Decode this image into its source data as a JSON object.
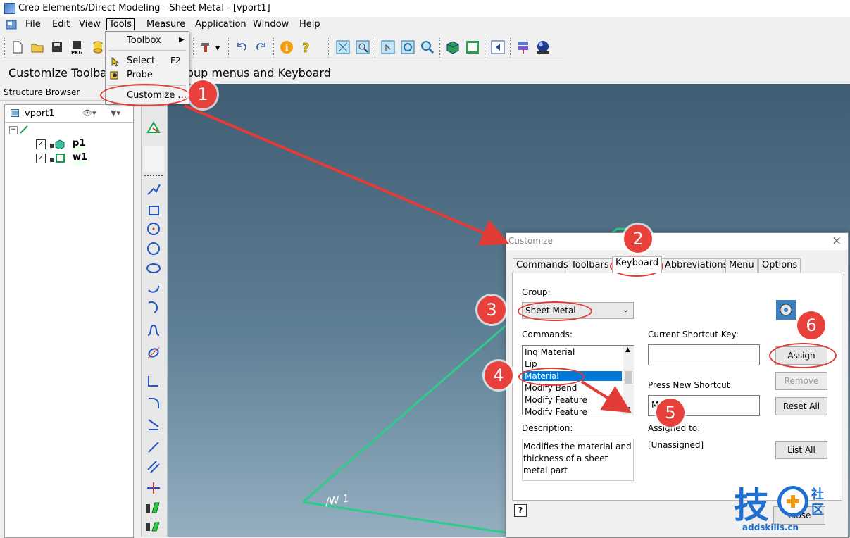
{
  "window": {
    "title": "Creo Elements/Direct Modeling - Sheet Metal - [vport1]"
  },
  "menubar": {
    "items": [
      "File",
      "Edit",
      "View",
      "Tools",
      "Measure",
      "Application",
      "Window",
      "Help"
    ]
  },
  "tools_menu": {
    "toolbox": "Toolbox",
    "select": "Select",
    "select_shortcut": "F2",
    "probe": "Probe",
    "customize": "Customize ..."
  },
  "status": {
    "prompt_left": "Customize Toolba",
    "prompt_right": "opup menus and Keyboard"
  },
  "structure_browser": {
    "header": "Structure Browser",
    "viewport": "vport1",
    "items": [
      "p1",
      "w1"
    ]
  },
  "viewport_label": "/W 1",
  "dialog": {
    "title": "Customize",
    "tabs": [
      "Commands",
      "Toolbars",
      "Keyboard",
      "Abbreviations",
      "Menu",
      "Options"
    ],
    "selected_tab": "Keyboard",
    "group_label": "Group:",
    "group_value": "Sheet Metal",
    "commands_label": "Commands:",
    "commands": [
      "Inq Material",
      "Lip",
      "Material",
      "Modify Bend",
      "Modify Feature",
      "Modify Feature"
    ],
    "selected_command": "Material",
    "current_shortcut_label": "Current Shortcut Key:",
    "current_shortcut_value": "",
    "new_shortcut_label": "Press New Shortcut",
    "new_shortcut_value": "M",
    "description_label": "Description:",
    "description_text": "Modifies the material and thickness of a sheet metal part",
    "assigned_label": "Assigned to:",
    "assigned_value": "[Unassigned]",
    "buttons": {
      "assign": "Assign",
      "remove": "Remove",
      "reset_all": "Reset All",
      "list_all": "List All",
      "close": "Close"
    },
    "help_glyph": "?"
  },
  "callouts": [
    "1",
    "2",
    "3",
    "4",
    "5",
    "6"
  ],
  "watermark": {
    "main": "技",
    "side_top": "社",
    "side_bottom": "区",
    "url": "addskills.cn"
  },
  "colors": {
    "callout": "#e8403a",
    "selection": "#0078d7",
    "viewport_top": "#3f5d73",
    "wire": "#2ecc8a"
  }
}
